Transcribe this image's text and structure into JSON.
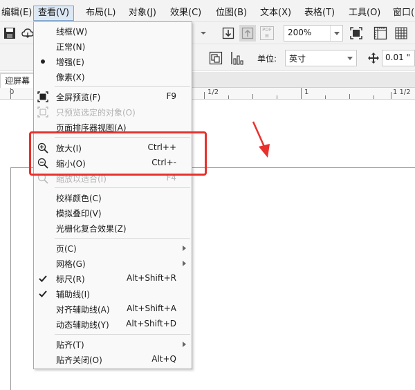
{
  "menubar": {
    "items": [
      {
        "label": "编辑(E)"
      },
      {
        "label": "查看(V)"
      },
      {
        "label": "布局(L)"
      },
      {
        "label": "对象(J)"
      },
      {
        "label": "效果(C)"
      },
      {
        "label": "位图(B)"
      },
      {
        "label": "文本(X)"
      },
      {
        "label": "表格(T)"
      },
      {
        "label": "工具(O)"
      },
      {
        "label": "窗口("
      }
    ]
  },
  "toolbar": {
    "zoom_value": "200%",
    "pdf_label": "PDF"
  },
  "property_bar": {
    "unit_label": "单位:",
    "unit_value": "英寸",
    "nudge_value": "0.01 \""
  },
  "doc_tab": {
    "label": "迎屏幕"
  },
  "ruler": {
    "labels": [
      "0",
      "1/2",
      "1",
      "1 1/2"
    ]
  },
  "view_menu": {
    "items": [
      {
        "label": "线框(W)"
      },
      {
        "label": "正常(N)"
      },
      {
        "label": "增强(E)"
      },
      {
        "label": "像素(X)"
      },
      {
        "label": "全屏预览(F)",
        "shortcut": "F9"
      },
      {
        "label": "只预览选定的对象(O)"
      },
      {
        "label": "页面排序器视图(A)"
      },
      {
        "label": "放大(I)",
        "shortcut": "Ctrl++"
      },
      {
        "label": "缩小(O)",
        "shortcut": "Ctrl+-"
      },
      {
        "label": "缩放以适合(I)",
        "shortcut": "F4"
      },
      {
        "label": "校样颜色(C)"
      },
      {
        "label": "模拟叠印(V)"
      },
      {
        "label": "光栅化复合效果(Z)"
      },
      {
        "label": "页(C)"
      },
      {
        "label": "网格(G)"
      },
      {
        "label": "标尺(R)",
        "shortcut": "Alt+Shift+R"
      },
      {
        "label": "辅助线(I)"
      },
      {
        "label": "对齐辅助线(A)",
        "shortcut": "Alt+Shift+A"
      },
      {
        "label": "动态辅助线(Y)",
        "shortcut": "Alt+Shift+D"
      },
      {
        "label": "贴齐(T)"
      },
      {
        "label": "贴齐关闭(O)",
        "shortcut": "Alt+Q"
      }
    ]
  },
  "colors": {
    "highlight_box": "#e8312c",
    "annotation_arrow": "#e8312c",
    "menu_active_bg": "#dde8f5"
  },
  "icons": {
    "zoom_in": "zoom-in-icon",
    "zoom_out": "zoom-out-icon",
    "full_screen": "full-screen-icon",
    "check": "check-icon",
    "bullet": "radio-bullet-icon"
  }
}
